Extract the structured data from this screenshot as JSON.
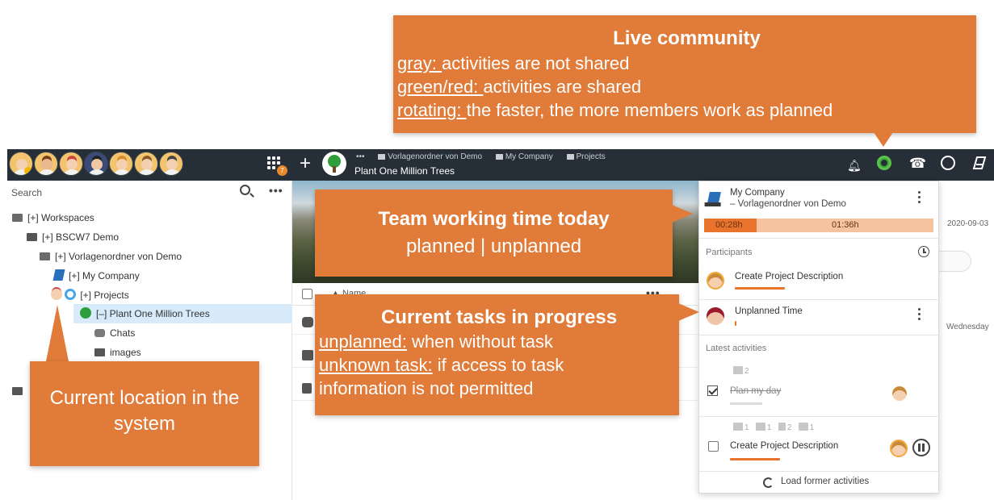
{
  "callouts": {
    "live": {
      "title": "Live community",
      "line1_key": "gray: ",
      "line1_text": "activities are not shared",
      "line2_key": "green/red: ",
      "line2_text": "activities are shared",
      "line3_key": "rotating: ",
      "line3_text": "the faster, the more members work as planned"
    },
    "team_time": {
      "title": "Team working time today",
      "subtitle": "planned | unplanned"
    },
    "tasks": {
      "title": "Current tasks in progress",
      "line1_key": "unplanned:",
      "line1_text": " when without task",
      "line2_key": "unknown task:",
      "line2_text": " if access to task",
      "line3_text": "information is not permitted"
    },
    "location": {
      "text": "Current location in the system"
    }
  },
  "topbar": {
    "apps_badge": "7",
    "plus_label": "+",
    "crumbs": [
      "Vorlagenordner von Demo",
      "My Company",
      "Projects"
    ],
    "page_name": "Plant One Million Trees",
    "icons": [
      "bell-icon",
      "live-community-icon",
      "phone-icon",
      "clock-icon",
      "bscw-logo-icon"
    ]
  },
  "sidebar": {
    "search_label": "Search",
    "tree": [
      {
        "label": "[+] Workspaces"
      },
      {
        "label": "[+] BSCW7 Demo"
      },
      {
        "label": "[+] Vorlagenordner von Demo"
      },
      {
        "label": "[+] My Company"
      },
      {
        "label": "[+] Projects"
      },
      {
        "label": "[–] Plant One Million Trees"
      },
      {
        "label": "Chats"
      },
      {
        "label": "images"
      }
    ]
  },
  "main": {
    "name_header": "Name",
    "date": "2020-09-03",
    "weekday": "Wednesday"
  },
  "panel": {
    "workspace": "My Company",
    "subfolder": "– Vorlagenordner von Demo",
    "planned_time": "00:28h",
    "unplanned_time": "01:36h",
    "planned_fraction": 0.23,
    "participants_label": "Participants",
    "participants": [
      {
        "task": "Create Project Description"
      },
      {
        "task": "Unplanned Time"
      }
    ],
    "latest_label": "Latest activities",
    "activities": [
      {
        "title": "Plan my day",
        "chat_count": "2"
      },
      {
        "title": "Create Project Description",
        "counts": [
          "1",
          "1",
          "2",
          "1"
        ]
      }
    ],
    "load_former": "Load former activities"
  },
  "colors": {
    "accent": "#e07b39",
    "topbar": "#262f38",
    "selected": "#d7ebfb",
    "live_green": "#3aaa35"
  }
}
